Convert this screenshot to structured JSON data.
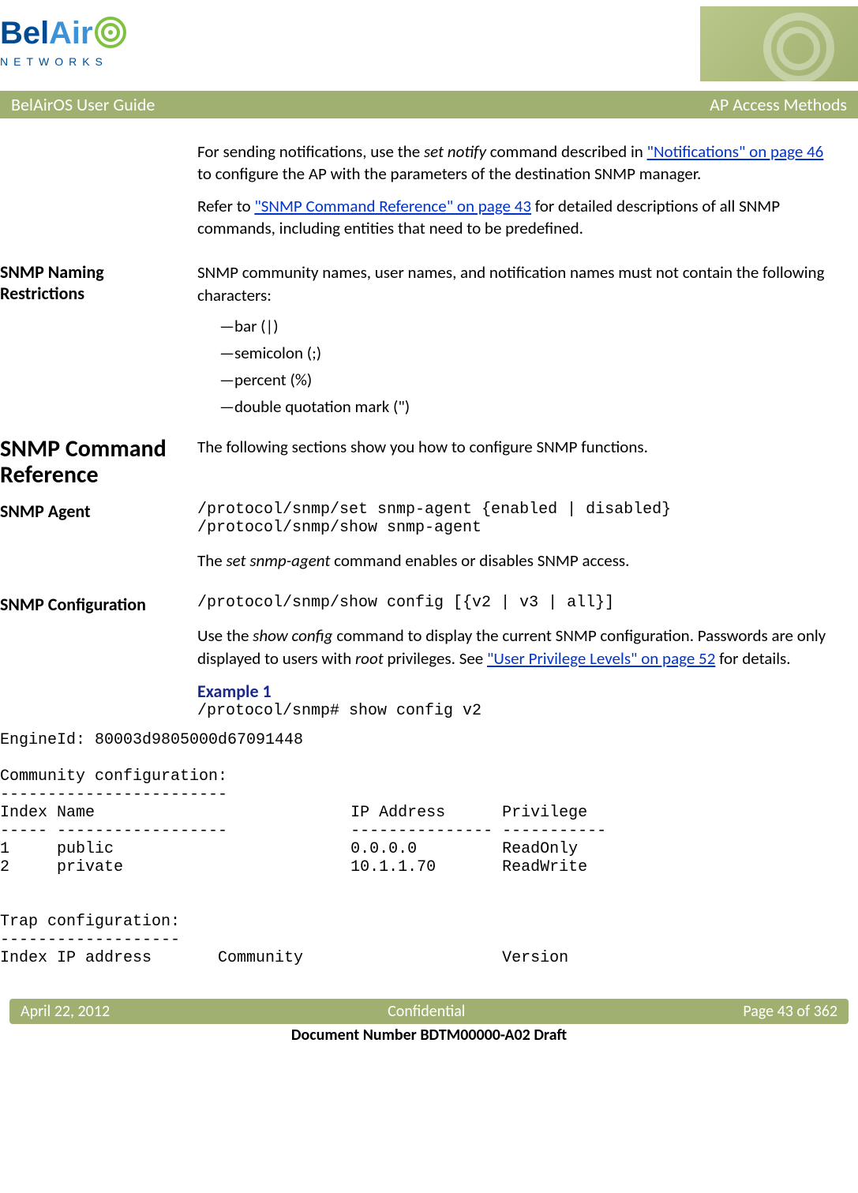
{
  "logo": {
    "name": "BelAir",
    "sub": "N E T W O R K S"
  },
  "titlebar": {
    "left": "BelAirOS User Guide",
    "right": "AP Access Methods"
  },
  "intro": {
    "p1_a": "For sending notifications, use the ",
    "p1_cmd": "set notify",
    "p1_b": " command described in ",
    "p1_link": "\"Notifications\" on page 46",
    "p1_c": " to configure the AP with the parameters of the destination SNMP manager.",
    "p2_a": "Refer to ",
    "p2_link": "\"SNMP Command Reference\" on page 43",
    "p2_b": " for detailed descriptions of all SNMP commands, including entities that need to be predefined."
  },
  "naming": {
    "head": "SNMP Naming Restrictions",
    "intro": "SNMP community names, user names, and notification names must not contain the following characters:",
    "items": [
      "—bar (|)",
      "—semicolon (;)",
      "—percent (%)",
      "—double quotation mark (\")"
    ]
  },
  "cmdref": {
    "head": "SNMP Command Reference",
    "text": "The following sections show you how to configure SNMP functions."
  },
  "agent": {
    "head": "SNMP Agent",
    "cmd1": "/protocol/snmp/set snmp-agent {enabled | disabled}",
    "cmd2": "/protocol/snmp/show snmp-agent",
    "desc_a": "The ",
    "desc_cmd": "set snmp-agent",
    "desc_b": " command enables or disables SNMP access."
  },
  "config": {
    "head": "SNMP Configuration",
    "cmd": "/protocol/snmp/show config [{v2 | v3 | all}]",
    "desc_a": "Use the ",
    "desc_cmd": "show config",
    "desc_b": " command to display the current SNMP configuration. Passwords are only displayed to users with ",
    "desc_root": "root",
    "desc_c": " privileges. See ",
    "desc_link": "\"User Privilege Levels\" on page 52",
    "desc_d": " for details.",
    "example_head": "Example 1",
    "example_cmd": "/protocol/snmp# show config v2"
  },
  "output": "EngineId: 80003d9805000d67091448\n\nCommunity configuration:\n------------------------\nIndex Name                           IP Address      Privilege\n----- ------------------             --------------- -----------\n1     public                         0.0.0.0         ReadOnly\n2     private                        10.1.1.70       ReadWrite\n\n\nTrap configuration:\n-------------------\nIndex IP address       Community                     Version",
  "footer": {
    "date": "April 22, 2012",
    "mid": "Confidential",
    "page": "Page 43 of 362",
    "docnum": "Document Number BDTM00000-A02 Draft"
  }
}
